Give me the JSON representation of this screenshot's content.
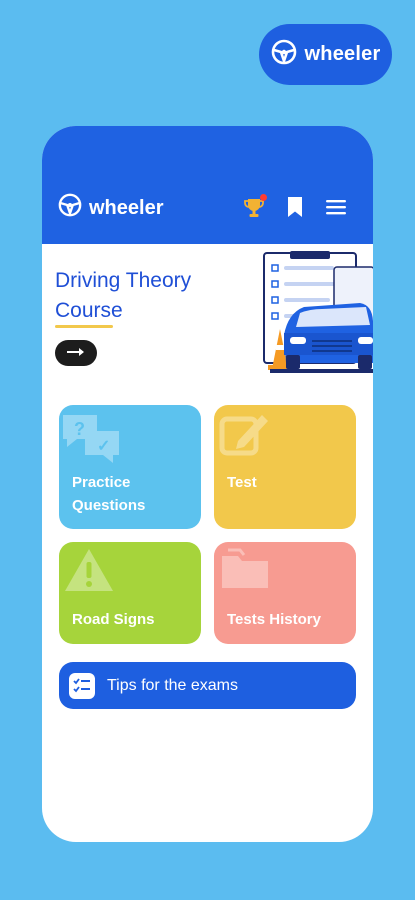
{
  "brand": {
    "name": "wheeler",
    "icon": "steering-wheel-icon"
  },
  "header": {
    "logo_text": "wheeler",
    "icons": [
      "trophy-icon",
      "bookmark-icon",
      "menu-icon"
    ],
    "notification_dot": true
  },
  "hero": {
    "title": "Driving Theory Course",
    "cta_icon": "arrow-right-icon"
  },
  "tiles": [
    {
      "label": "Practice Questions",
      "color": "#5cc2ee",
      "icon": "chat-question-icon"
    },
    {
      "label": "Test",
      "color": "#f2c84b",
      "icon": "edit-icon"
    },
    {
      "label": "Road Signs",
      "color": "#a6d43b",
      "icon": "warning-icon"
    },
    {
      "label": "Tests History",
      "color": "#f79b91",
      "icon": "folder-icon"
    }
  ],
  "tips": {
    "label": "Tips for the exams",
    "icon": "checklist-icon"
  },
  "colors": {
    "background": "#5bbcf0",
    "primary": "#1f62e2",
    "accent_yellow": "#f2c84b",
    "text_blue": "#1f4fd6"
  }
}
